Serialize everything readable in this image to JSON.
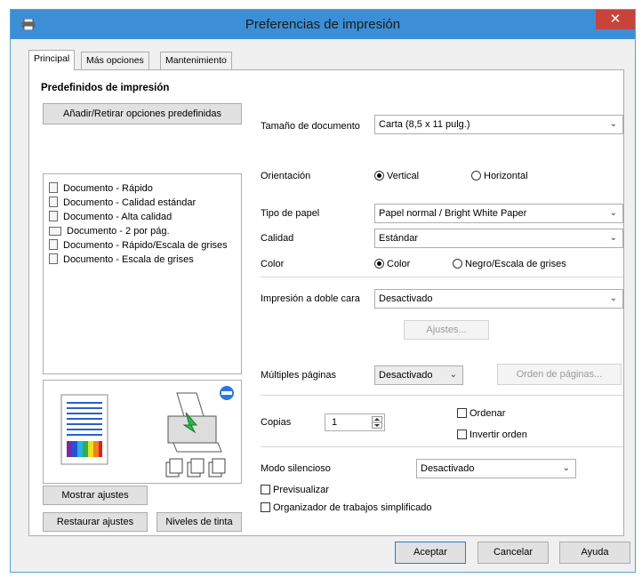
{
  "window": {
    "title": "Preferencias de impresión",
    "close_icon": "close-icon"
  },
  "tabs": [
    {
      "label": "Principal"
    },
    {
      "label": "Más opciones"
    },
    {
      "label": "Mantenimiento"
    }
  ],
  "presets": {
    "heading": "Predefinidos de impresión",
    "add_remove_label": "Añadir/Retirar opciones predefinidas",
    "items": [
      "Documento - Rápido",
      "Documento - Calidad estándar",
      "Documento - Alta calidad",
      "Documento - 2 por pág.",
      "Documento - Rápido/Escala de grises",
      "Documento - Escala de grises"
    ]
  },
  "settings": {
    "doc_size_label": "Tamaño de documento",
    "doc_size_value": "Carta (8,5 x 11 pulg.)",
    "orientation_label": "Orientación",
    "orientation_vertical": "Vertical",
    "orientation_horizontal": "Horizontal",
    "paper_type_label": "Tipo de papel",
    "paper_type_value": "Papel normal / Bright White Paper",
    "quality_label": "Calidad",
    "quality_value": "Estándar",
    "color_label": "Color",
    "color_option": "Color",
    "grayscale_option": "Negro/Escala de grises",
    "duplex_label": "Impresión a doble cara",
    "duplex_value": "Desactivado",
    "adjust_label": "Ajustes...",
    "multipage_label": "Múltiples páginas",
    "multipage_value": "Desactivado",
    "page_order_label": "Orden de páginas...",
    "copies_label": "Copias",
    "copies_value": "1",
    "collate_label": "Ordenar",
    "reverse_label": "Invertir orden",
    "quiet_label": "Modo silencioso",
    "quiet_value": "Desactivado",
    "preview_label": "Previsualizar",
    "organizer_label": "Organizador de trabajos simplificado"
  },
  "bottom_left": {
    "show_settings": "Mostrar ajustes",
    "restore_settings": "Restaurar ajustes",
    "ink_levels": "Niveles de tinta"
  },
  "footer": {
    "ok": "Aceptar",
    "cancel": "Cancelar",
    "help": "Ayuda"
  },
  "colors": {
    "titlebar": "#3c8fd6",
    "close": "#c7443b",
    "accent": "#2a7ad5"
  }
}
